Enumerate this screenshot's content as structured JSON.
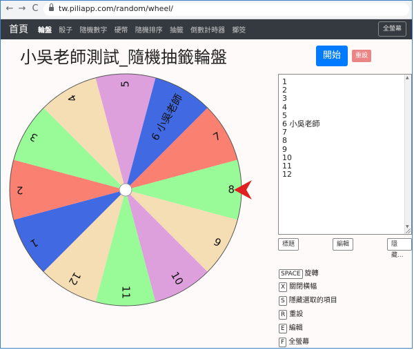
{
  "browser": {
    "back_glyph": "←",
    "forward_glyph": "→",
    "reload_glyph": "C",
    "url": "tw.piliapp.com/random/wheel/"
  },
  "navbar": {
    "brand": "首頁",
    "items": [
      {
        "label": "輪盤",
        "active": true
      },
      {
        "label": "骰子"
      },
      {
        "label": "隨機數字"
      },
      {
        "label": "硬幣"
      },
      {
        "label": "隨機排序"
      },
      {
        "label": "抽籤"
      },
      {
        "label": "倒數計時器"
      },
      {
        "label": "擲筊"
      }
    ],
    "fullscreen_label": "全螢幕"
  },
  "title": "小吳老師測試_隨機抽籤輪盤",
  "buttons": {
    "start": "開始",
    "reset": "重設"
  },
  "list_text": "1\n2\n3\n4\n5\n6 小吳老師\n7\n8\n9\n10\n11\n12",
  "tools": {
    "title": "標題",
    "edit": "編輯",
    "hide": "隱藏..."
  },
  "shortcuts": [
    {
      "key": "SPACE",
      "label": "旋轉"
    },
    {
      "key": "X",
      "label": "關閉橫幅"
    },
    {
      "key": "S",
      "label": "隱藏選取的項目"
    },
    {
      "key": "R",
      "label": "重設"
    },
    {
      "key": "E",
      "label": "編輯"
    },
    {
      "key": "F",
      "label": "全螢幕"
    }
  ],
  "wheel": {
    "segments": [
      {
        "label": "1",
        "color": "#4169e1"
      },
      {
        "label": "2",
        "color": "#fa8072"
      },
      {
        "label": "3",
        "color": "#98fb98"
      },
      {
        "label": "4",
        "color": "#f5deb3"
      },
      {
        "label": "5",
        "color": "#dda0dd"
      },
      {
        "label": "6 小吳老師",
        "color": "#4169e1"
      },
      {
        "label": "7",
        "color": "#fa8072"
      },
      {
        "label": "8",
        "color": "#98fb98"
      },
      {
        "label": "9",
        "color": "#f5deb3"
      },
      {
        "label": "10",
        "color": "#dda0dd"
      },
      {
        "label": "11",
        "color": "#98fb98"
      },
      {
        "label": "12",
        "color": "#f5deb3"
      }
    ],
    "pointer_color": "#e02020"
  }
}
